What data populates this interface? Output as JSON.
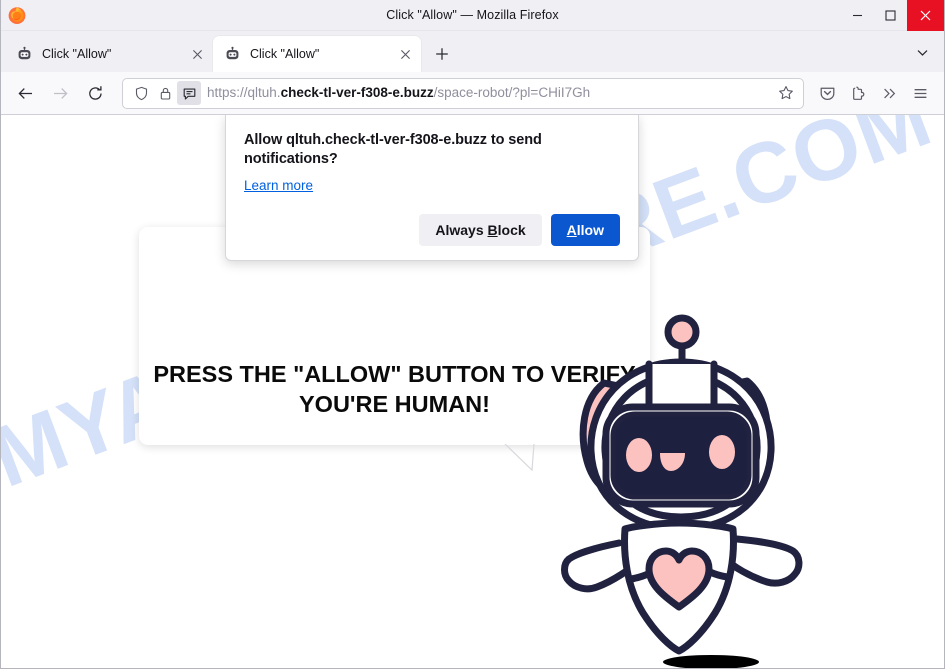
{
  "window": {
    "title": "Click \"Allow\" — Mozilla Firefox",
    "app_icon": "firefox-logo",
    "controls": {
      "minimize": "minimize-icon",
      "maximize": "maximize-icon",
      "close": "close-icon",
      "close_color": "#e81123"
    }
  },
  "tabs": {
    "items": [
      {
        "label": "Click \"Allow\"",
        "favicon": "robot-favicon",
        "active": false
      },
      {
        "label": "Click \"Allow\"",
        "favicon": "robot-favicon",
        "active": true
      }
    ],
    "new_tab_label": "+",
    "list_all_tabs_icon": "chevron-down-icon"
  },
  "toolbar": {
    "back_icon": "arrow-left-icon",
    "forward_icon": "arrow-right-icon",
    "reload_icon": "reload-icon",
    "shield_icon": "shield-icon",
    "lock_icon": "padlock-icon",
    "permission_icon": "notification-bubble-icon",
    "bookmark_icon": "star-outline-icon",
    "pocket_icon": "pocket-icon",
    "extensions_icon": "puzzle-piece-icon",
    "overflow_icon": "double-chevron-right-icon",
    "menu_icon": "hamburger-menu-icon"
  },
  "url": {
    "scheme": "https://",
    "subdomain": "qltuh.",
    "domain": "check-tl-ver-f308-e.buzz",
    "path": "/space-robot/?pl=CHiI7Gh",
    "full": "https://qltuh.check-tl-ver-f308-e.buzz/space-robot/?pl=CHiI7Gh"
  },
  "doorhanger": {
    "title": "Allow qltuh.check-tl-ver-f308-e.buzz to send notifications?",
    "learn_more": "Learn more",
    "block_label_pre": "Always ",
    "block_label_key": "B",
    "block_label_post": "lock",
    "allow_label_key": "A",
    "allow_label_post": "llow",
    "primary_color": "#0b57d0",
    "secondary_color": "#f0f0f4"
  },
  "page": {
    "headline": "PRESS THE \"ALLOW\" BUTTON TO VERIFY YOU'RE HUMAN!",
    "watermark": "MYANTISPYWARE.COM",
    "watermark_color": "#d4e1f8",
    "illustration": "space-robot-illustration",
    "illustration_colors": {
      "outline": "#20223f",
      "accent_pink": "#fcc2c0",
      "visor": "#1e2040",
      "body": "#ffffff"
    }
  }
}
